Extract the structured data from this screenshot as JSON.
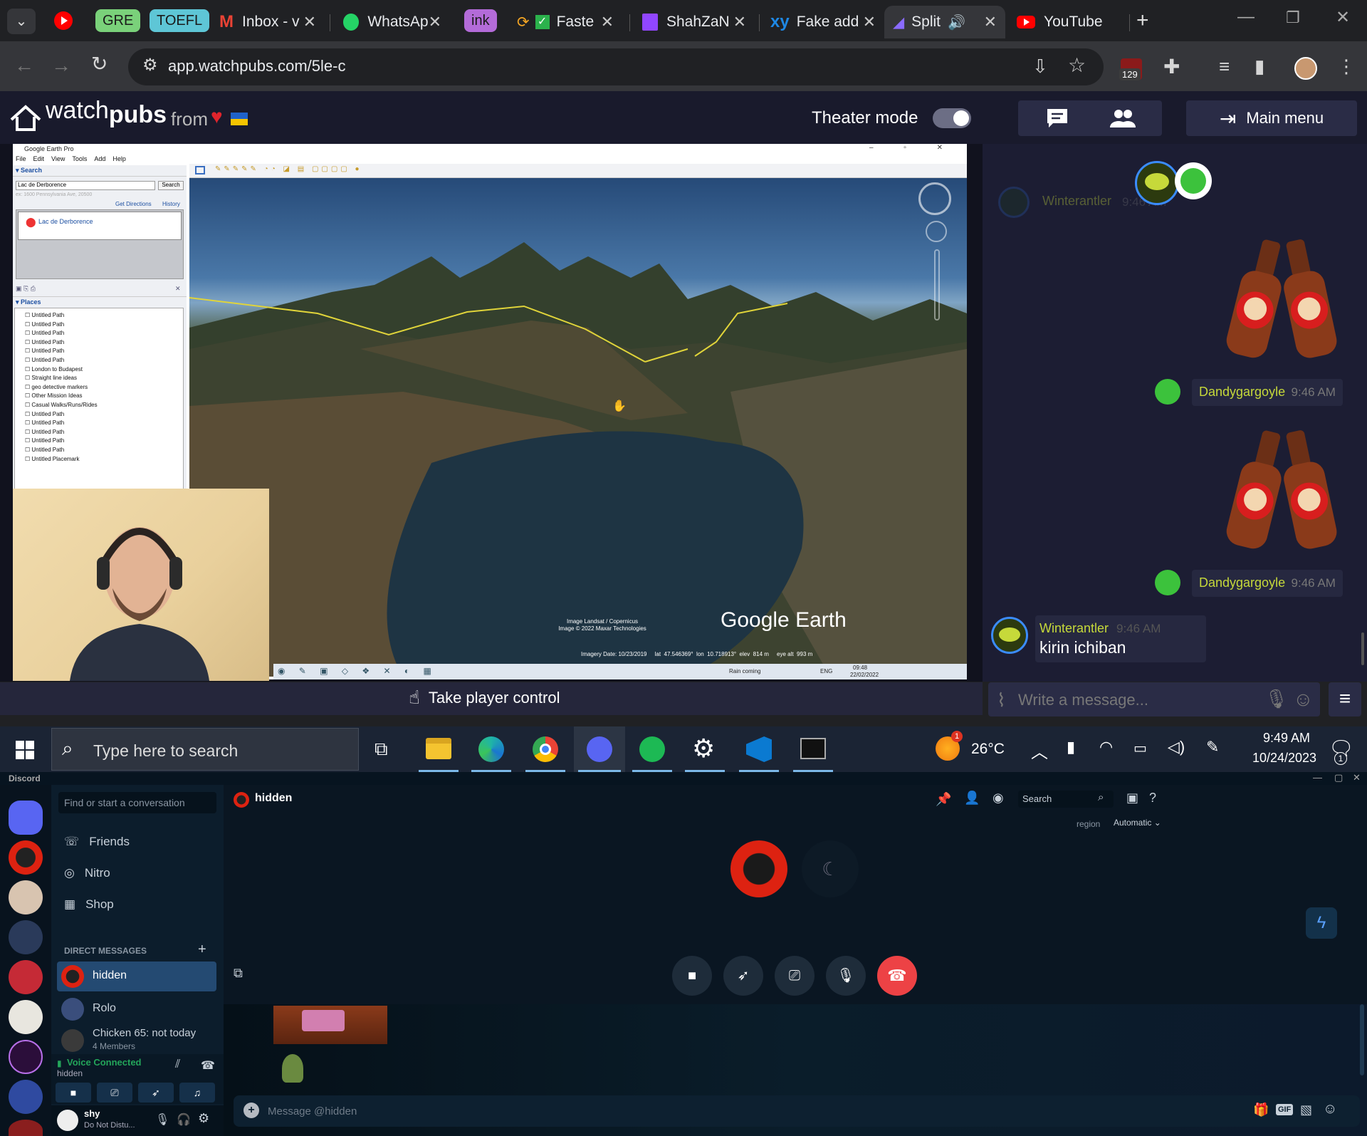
{
  "browser": {
    "tabs": [
      {
        "label": "GRE",
        "kind": "pill",
        "color": "#7ad17a"
      },
      {
        "label": "TOEFL",
        "kind": "pill",
        "color": "#5ec6d6"
      },
      {
        "label": "Inbox - v",
        "icon": "gmail-icon"
      },
      {
        "label": "WhatsAp",
        "icon": "whatsapp-icon"
      },
      {
        "label": "ink",
        "kind": "pill",
        "color": "#b36bd8"
      },
      {
        "label": "Faste",
        "icon": "checkbox-icon"
      },
      {
        "label": "ShahZaN",
        "icon": "twitch-icon"
      },
      {
        "label": "Fake add",
        "icon": "xy-icon"
      },
      {
        "label": "Split",
        "icon": "split-icon",
        "active": true
      },
      {
        "label": "YouTube",
        "icon": "youtube-icon"
      }
    ],
    "url": "app.watchpubs.com/5le-c",
    "extension_badge": "129",
    "new_tab": "+"
  },
  "watchpubs": {
    "logo_text_light": "watch",
    "logo_text_bold": "pubs",
    "from": "from",
    "theater_mode": "Theater mode",
    "theater_on": true,
    "main_menu": "Main menu",
    "take_control": "Take player control",
    "message_placeholder": "Write a message...",
    "chat": [
      {
        "user": "Winterantler",
        "time": "9:46 AM",
        "text": "",
        "faded": true
      },
      {
        "user": "Dandygargoyle",
        "time": "9:46 AM",
        "text": ""
      },
      {
        "user": "Dandygargoyle",
        "time": "9:46 AM",
        "text": ""
      },
      {
        "user": "Winterantler",
        "time": "9:46 AM",
        "text": "kirin ichiban"
      }
    ]
  },
  "google_earth": {
    "title": "Google Earth Pro",
    "menu": [
      "File",
      "Edit",
      "View",
      "Tools",
      "Add",
      "Help"
    ],
    "search_label": "Search",
    "search_value": "Lac de Derborence",
    "search_btn": "Search",
    "search_hint": "ex: 1600 Pennsylvania Ave, 20500",
    "get_directions": "Get Directions",
    "history": "History",
    "result": "Lac de Derborence",
    "places_label": "Places",
    "places": [
      "Untitled Path",
      "Untitled Path",
      "Untitled Path",
      "Untitled Path",
      "Untitled Path",
      "Untitled Path",
      "London to Budapest",
      "Straight line ideas",
      "geo detective markers",
      "Other Mission Ideas",
      "Casual Walks/Runs/Rides",
      "Untitled Path",
      "Untitled Path",
      "Untitled Path",
      "Untitled Path",
      "Untitled Path",
      "Untitled Placemark"
    ],
    "watermark": "Google Earth",
    "credits_1": "Image Landsat / Copernicus",
    "credits_2": "Image © 2022 Maxar Technologies",
    "status": "Imagery Date: 10/23/2019     lat  47.546369°  lon  10.718913°  elev  814 m     eye alt  993 m",
    "tray_weather": "Rain coming",
    "tray_lang": "ENG",
    "tray_time": "09:48",
    "tray_date": "22/02/2022"
  },
  "taskbar": {
    "search_placeholder": "Type here to search",
    "weather": "26°C",
    "time": "9:49 AM",
    "date": "10/24/2023",
    "notif_count": "1"
  },
  "discord": {
    "app_name": "Discord",
    "find_placeholder": "Find or start a conversation",
    "nav": [
      "Friends",
      "Nitro",
      "Shop"
    ],
    "dm_header": "DIRECT MESSAGES",
    "dms": [
      {
        "name": "hidden",
        "sub": "",
        "active": true
      },
      {
        "name": "Rolo",
        "sub": ""
      },
      {
        "name": "Chicken 65: not today",
        "sub": "4 Members"
      }
    ],
    "voice_status": "Voice Connected",
    "voice_channel": "hidden",
    "user_name": "shy",
    "user_status": "Do Not Distu...",
    "channel_title": "hidden",
    "search_placeholder": "Search",
    "region_label": "region",
    "region_value": "Automatic",
    "message_placeholder": "Message @hidden",
    "gif_label": "GIF"
  },
  "colors": {
    "watchpubs_accent": "#c6d93a",
    "discord_accent": "#5865f2",
    "hangup": "#ed4245",
    "voice_green": "#23a55a"
  }
}
